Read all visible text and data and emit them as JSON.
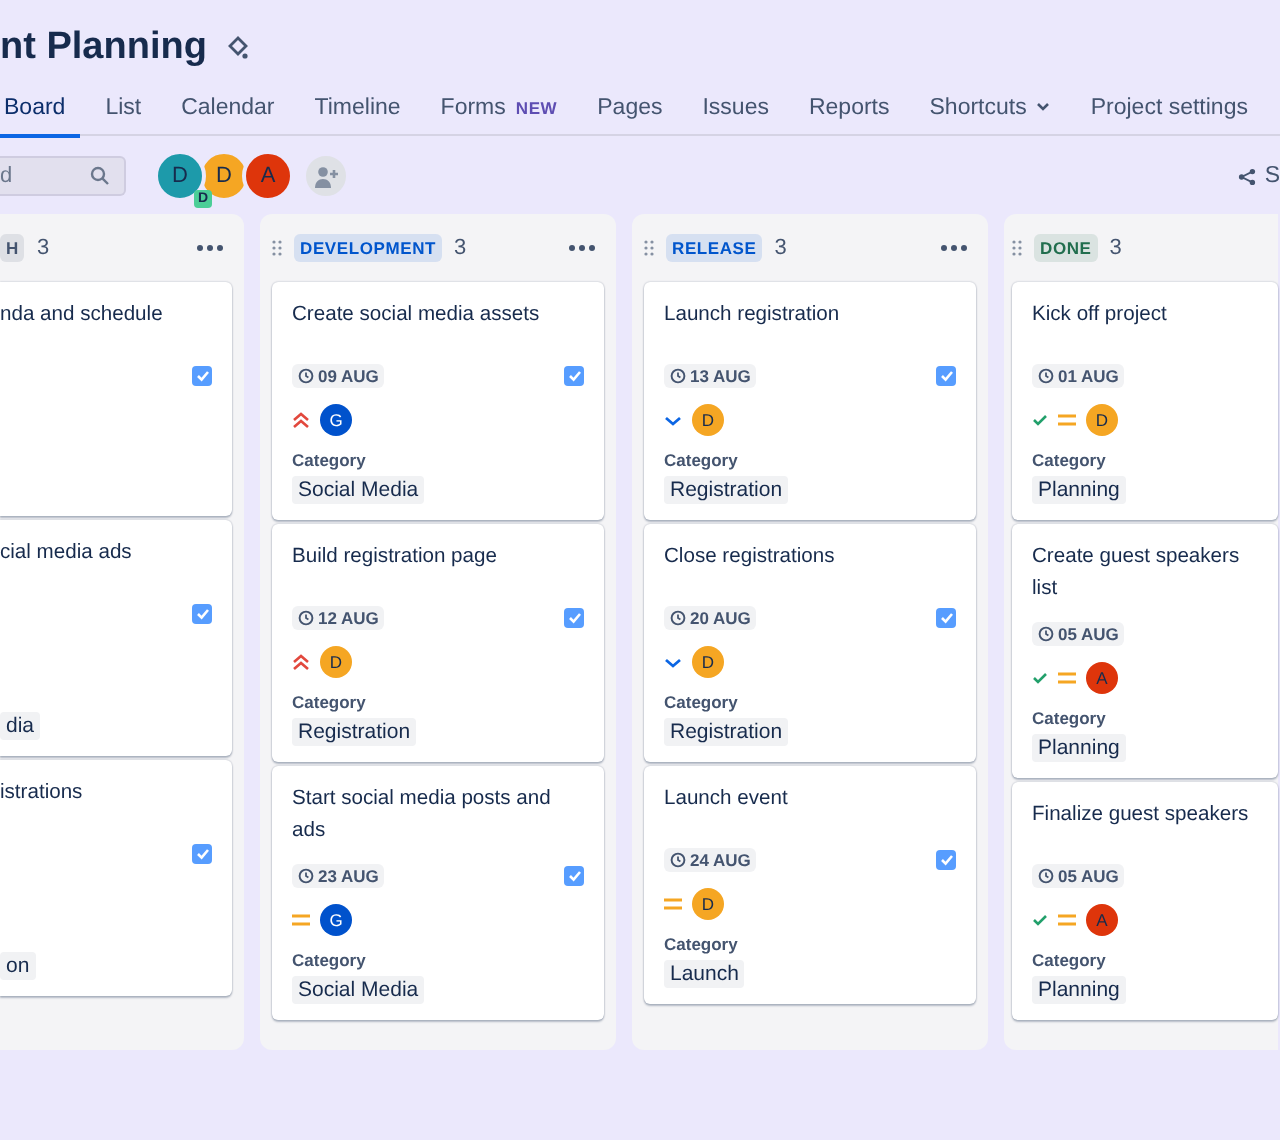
{
  "project": {
    "title": "nt Planning"
  },
  "tabs": [
    {
      "label": "Board",
      "selected": true
    },
    {
      "label": "List",
      "selected": false
    },
    {
      "label": "Calendar",
      "selected": false
    },
    {
      "label": "Timeline",
      "selected": false
    },
    {
      "label": "Forms",
      "badge": "NEW",
      "selected": false
    },
    {
      "label": "Pages",
      "selected": false
    },
    {
      "label": "Issues",
      "selected": false
    },
    {
      "label": "Reports",
      "selected": false
    },
    {
      "label": "Shortcuts",
      "dropdown": true,
      "selected": false
    },
    {
      "label": "Project settings",
      "selected": false
    }
  ],
  "search": {
    "placeholder": "d"
  },
  "people": [
    {
      "initial": "D",
      "color": "#1d9aaa",
      "badge": "D"
    },
    {
      "initial": "D",
      "color": "#f5a623"
    },
    {
      "initial": "A",
      "color": "#de350b"
    }
  ],
  "share": {
    "label": "S"
  },
  "columns": [
    {
      "name": "H",
      "color": "#44546f",
      "count": "3",
      "cards": [
        {
          "title": "nda and schedule",
          "checked": true
        },
        {
          "title": "cial media ads",
          "checked": true,
          "category": "dia"
        },
        {
          "title": "istrations",
          "checked": true,
          "category": "on"
        }
      ]
    },
    {
      "name": "DEVELOPMENT",
      "color": "#0055cc",
      "count": "3",
      "cards": [
        {
          "title": "Create social media assets",
          "due": "09 AUG",
          "checked": true,
          "priority": {
            "kind": "highest"
          },
          "assignee": {
            "initial": "G",
            "color": "#0052cc"
          },
          "category_label": "Category",
          "category": "Social Media"
        },
        {
          "title": "Build registration page",
          "due": "12 AUG",
          "checked": true,
          "priority": {
            "kind": "highest"
          },
          "assignee": {
            "initial": "D",
            "color": "#f5a623"
          },
          "category_label": "Category",
          "category": "Registration"
        },
        {
          "title": "Start social media posts and ads",
          "due": "23 AUG",
          "checked": true,
          "priority": {
            "kind": "medium"
          },
          "assignee": {
            "initial": "G",
            "color": "#0052cc"
          },
          "category_label": "Category",
          "category": "Social Media"
        }
      ]
    },
    {
      "name": "RELEASE",
      "color": "#0055cc",
      "count": "3",
      "cards": [
        {
          "title": "Launch registration",
          "due": "13 AUG",
          "checked": true,
          "priority": {
            "kind": "low"
          },
          "assignee": {
            "initial": "D",
            "color": "#f5a623"
          },
          "category_label": "Category",
          "category": "Registration"
        },
        {
          "title": "Close registrations",
          "due": "20 AUG",
          "checked": true,
          "priority": {
            "kind": "low"
          },
          "assignee": {
            "initial": "D",
            "color": "#f5a623"
          },
          "category_label": "Category",
          "category": "Registration"
        },
        {
          "title": "Launch event",
          "due": "24 AUG",
          "checked": true,
          "priority": {
            "kind": "medium"
          },
          "assignee": {
            "initial": "D",
            "color": "#f5a623"
          },
          "category_label": "Category",
          "category": "Launch"
        }
      ]
    },
    {
      "name": "DONE",
      "color": "#216e4e",
      "count": "3",
      "cards": [
        {
          "title": "Kick off project",
          "due": "01 AUG",
          "resolved": true,
          "priority": {
            "kind": "medium"
          },
          "assignee": {
            "initial": "D",
            "color": "#f5a623"
          },
          "category_label": "Category",
          "category": "Planning"
        },
        {
          "title": "Create guest speakers list",
          "due": "05 AUG",
          "resolved": true,
          "priority": {
            "kind": "medium"
          },
          "assignee": {
            "initial": "A",
            "color": "#de350b"
          },
          "category_label": "Category",
          "category": "Planning"
        },
        {
          "title": "Finalize guest speakers",
          "due": "05 AUG",
          "resolved": true,
          "priority": {
            "kind": "medium"
          },
          "assignee": {
            "initial": "A",
            "color": "#de350b"
          },
          "category_label": "Category",
          "category": "Planning"
        }
      ]
    }
  ]
}
